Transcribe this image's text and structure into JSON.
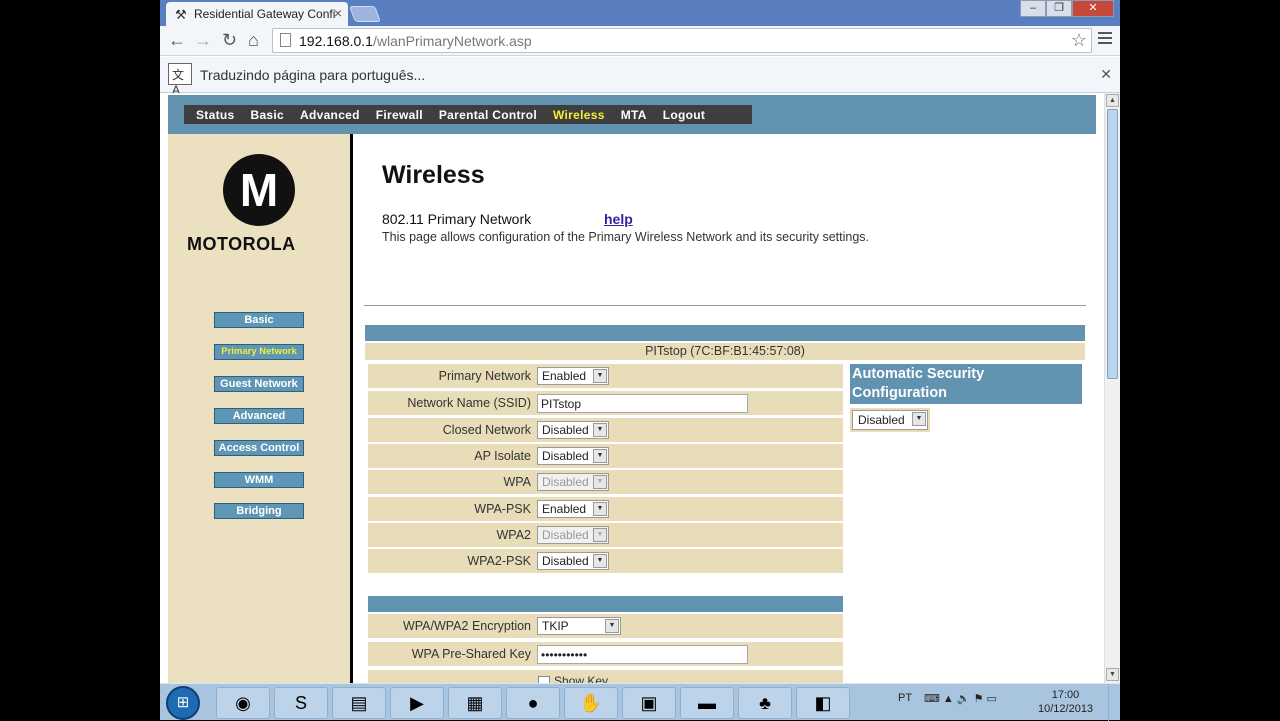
{
  "browser": {
    "tab_title": "Residential Gateway Confi",
    "url_host": "192.168.0.1",
    "url_path": "/wlanPrimaryNetwork.asp",
    "infobar_text": "Traduzindo página para português..."
  },
  "topnav": {
    "items": [
      "Status",
      "Basic",
      "Advanced",
      "Firewall",
      "Parental Control",
      "Wireless",
      "MTA",
      "Logout"
    ],
    "active": "Wireless"
  },
  "logo": {
    "text": "MOTOROLA",
    "mark": "M"
  },
  "sidebar": {
    "items": [
      "Basic",
      "Primary Network",
      "Guest Network",
      "Advanced",
      "Access Control",
      "WMM",
      "Bridging"
    ],
    "active": "Primary Network"
  },
  "main": {
    "title": "Wireless",
    "subtitle": "802.11 Primary Network",
    "help": "help",
    "description": "This page allows configuration of the Primary Wireless Network and its security settings.",
    "ssid_header": "PITstop (7C:BF:B1:45:57:08)"
  },
  "form": {
    "rows": [
      {
        "label": "Primary Network",
        "value": "Enabled"
      },
      {
        "label": "Network Name (SSID)",
        "value": "PITstop"
      },
      {
        "label": "Closed Network",
        "value": "Disabled"
      },
      {
        "label": "AP Isolate",
        "value": "Disabled"
      },
      {
        "label": "WPA",
        "value": "Disabled"
      },
      {
        "label": "WPA-PSK",
        "value": "Enabled"
      },
      {
        "label": "WPA2",
        "value": "Disabled"
      },
      {
        "label": "WPA2-PSK",
        "value": "Disabled"
      }
    ],
    "encryption": {
      "label": "WPA/WPA2 Encryption",
      "value": "TKIP"
    },
    "psk": {
      "label": "WPA Pre-Shared Key",
      "value": "•••••••••••"
    },
    "show_key": "Show Key"
  },
  "auto_security": {
    "title": "Automatic Security Configuration",
    "value": "Disabled"
  },
  "taskbar": {
    "lang": "PT",
    "time": "17:00",
    "date": "10/12/2013"
  },
  "colors": {
    "nav_blue": "#6193b0",
    "sidebar_beige": "#ebe1c0",
    "active_yellow": "#f5ef39"
  }
}
